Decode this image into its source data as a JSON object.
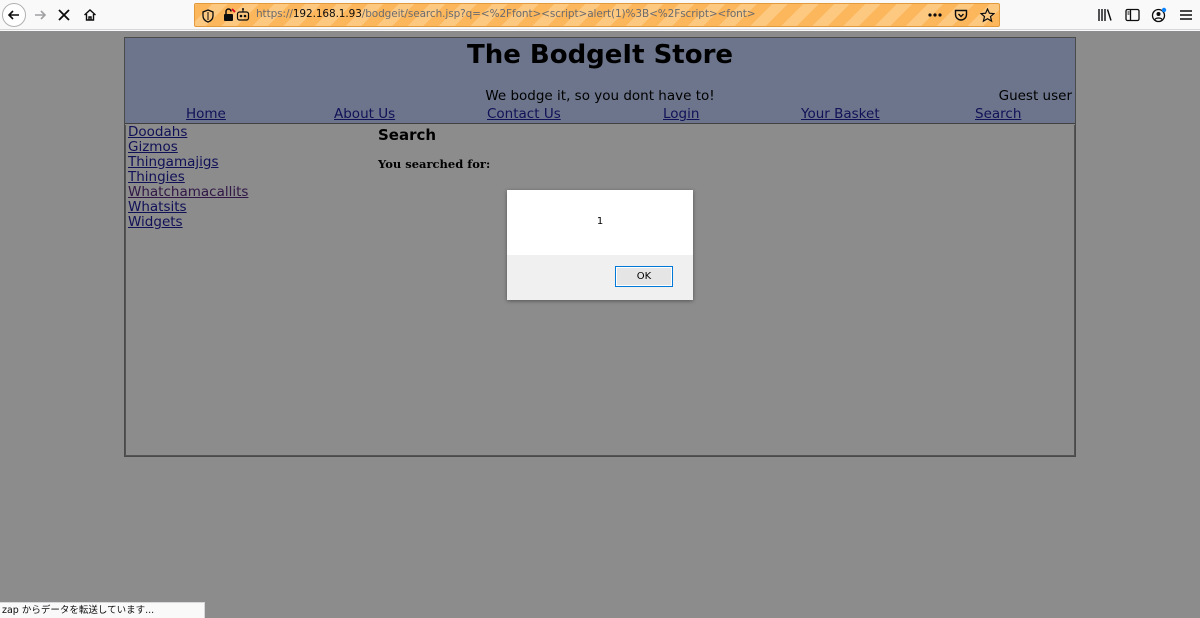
{
  "browser": {
    "url_prefix": "https://",
    "url_host": "192.168.1.93",
    "url_path": "/bodgeit/search.jsp?q=<%2Ffont><script>alert(1)%3B<%2Fscript><font>",
    "icons": {
      "back": "arrow-left-icon",
      "forward": "arrow-right-icon",
      "stop": "close-icon",
      "home": "home-icon",
      "tracking": "shield-icon",
      "insecure": "broken-lock-icon",
      "remote": "robot-icon",
      "page_actions": "more-icon",
      "pocket": "pocket-icon",
      "bookmark": "star-icon",
      "library": "library-icon",
      "sidebar": "sidebar-icon",
      "account": "account-icon",
      "menu": "hamburger-icon"
    },
    "status_text": "zap からデータを転送しています..."
  },
  "store": {
    "title": "The BodgeIt Store",
    "tagline": "We bodge it, so you dont have to!",
    "user": "Guest user",
    "nav": [
      {
        "label": "Home"
      },
      {
        "label": "About Us"
      },
      {
        "label": "Contact Us"
      },
      {
        "label": "Login"
      },
      {
        "label": "Your Basket"
      },
      {
        "label": "Search"
      }
    ],
    "categories": [
      {
        "label": "Doodahs"
      },
      {
        "label": "Gizmos"
      },
      {
        "label": "Thingamajigs"
      },
      {
        "label": "Thingies"
      },
      {
        "label": "Whatchamacallits"
      },
      {
        "label": "Whatsits"
      },
      {
        "label": "Widgets"
      }
    ],
    "search_heading": "Search",
    "searched_for": "You searched for:"
  },
  "alert": {
    "message": "1",
    "ok_label": "OK"
  },
  "colors": {
    "header_bg": "#c5d5fd",
    "link": "#2020a0",
    "visited_link": "#5a2a80",
    "urlbar_stripe_a": "#fcb65b",
    "urlbar_stripe_b": "#fdc981",
    "ok_border": "#0078d7"
  }
}
